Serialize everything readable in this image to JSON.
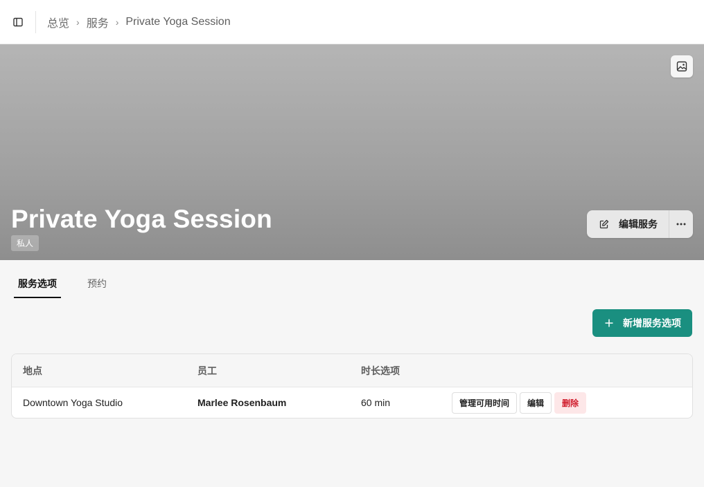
{
  "breadcrumb": {
    "items": [
      "总览",
      "服务"
    ],
    "current": "Private Yoga Session",
    "separator": "›"
  },
  "hero": {
    "title": "Private Yoga Session",
    "badge": "私人",
    "edit_label": "编辑服务",
    "more_label": "···"
  },
  "tabs": [
    {
      "label": "服务选项",
      "active": true
    },
    {
      "label": "预约",
      "active": false
    }
  ],
  "toolbar": {
    "add_label": "新增服务选项"
  },
  "table": {
    "headers": {
      "location": "地点",
      "staff": "员工",
      "duration": "时长选项"
    },
    "rows": [
      {
        "location": "Downtown Yoga Studio",
        "staff": "Marlee Rosenbaum",
        "duration": "60 min",
        "actions": {
          "manage": "管理可用时间",
          "edit": "编辑",
          "delete": "删除"
        }
      }
    ]
  },
  "colors": {
    "accent": "#1a8f80",
    "danger": "#d01c2c",
    "danger_bg": "#fde7e8"
  },
  "icons": {
    "sidebar_toggle": "sidebar-panel-icon",
    "image": "image-icon",
    "edit": "pencil-square-icon",
    "add": "plus-icon"
  }
}
